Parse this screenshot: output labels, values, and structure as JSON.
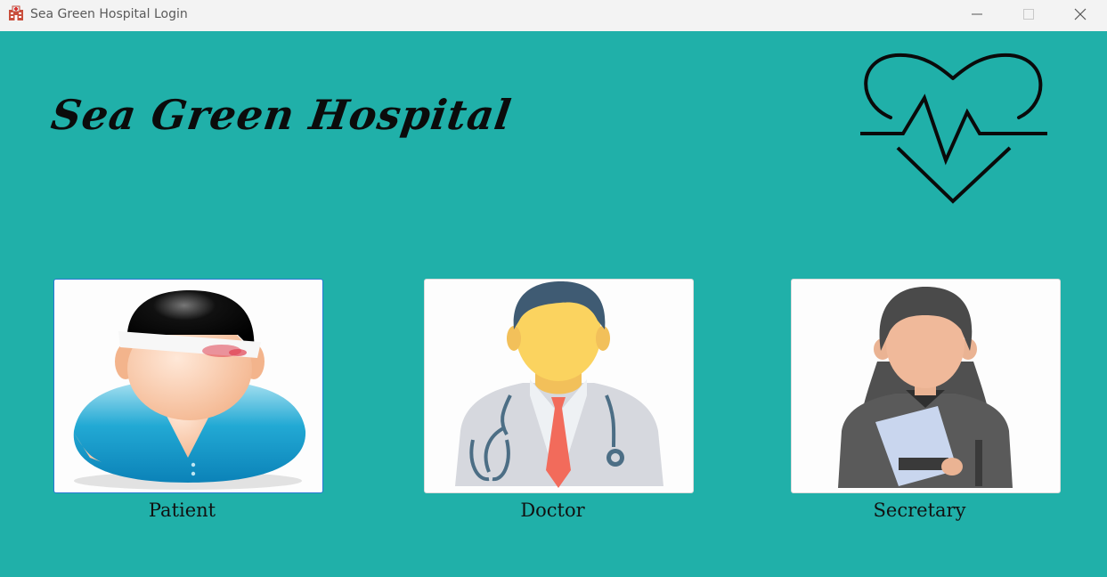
{
  "window": {
    "title": "Sea Green Hospital Login",
    "app_icon": "hospital-building-icon"
  },
  "header": {
    "hospital_name": "Sea Green Hospital",
    "logo_icon": "heartbeat-icon"
  },
  "roles": [
    {
      "label": "Patient",
      "icon": "patient-avatar-icon",
      "selected": true
    },
    {
      "label": "Doctor",
      "icon": "doctor-avatar-icon",
      "selected": false
    },
    {
      "label": "Secretary",
      "icon": "secretary-avatar-icon",
      "selected": false
    }
  ],
  "colors": {
    "background": "#20b0a9",
    "titlebar": "#f3f3f3",
    "card": "#fdfdfd",
    "selected_border": "#2a78d4"
  }
}
